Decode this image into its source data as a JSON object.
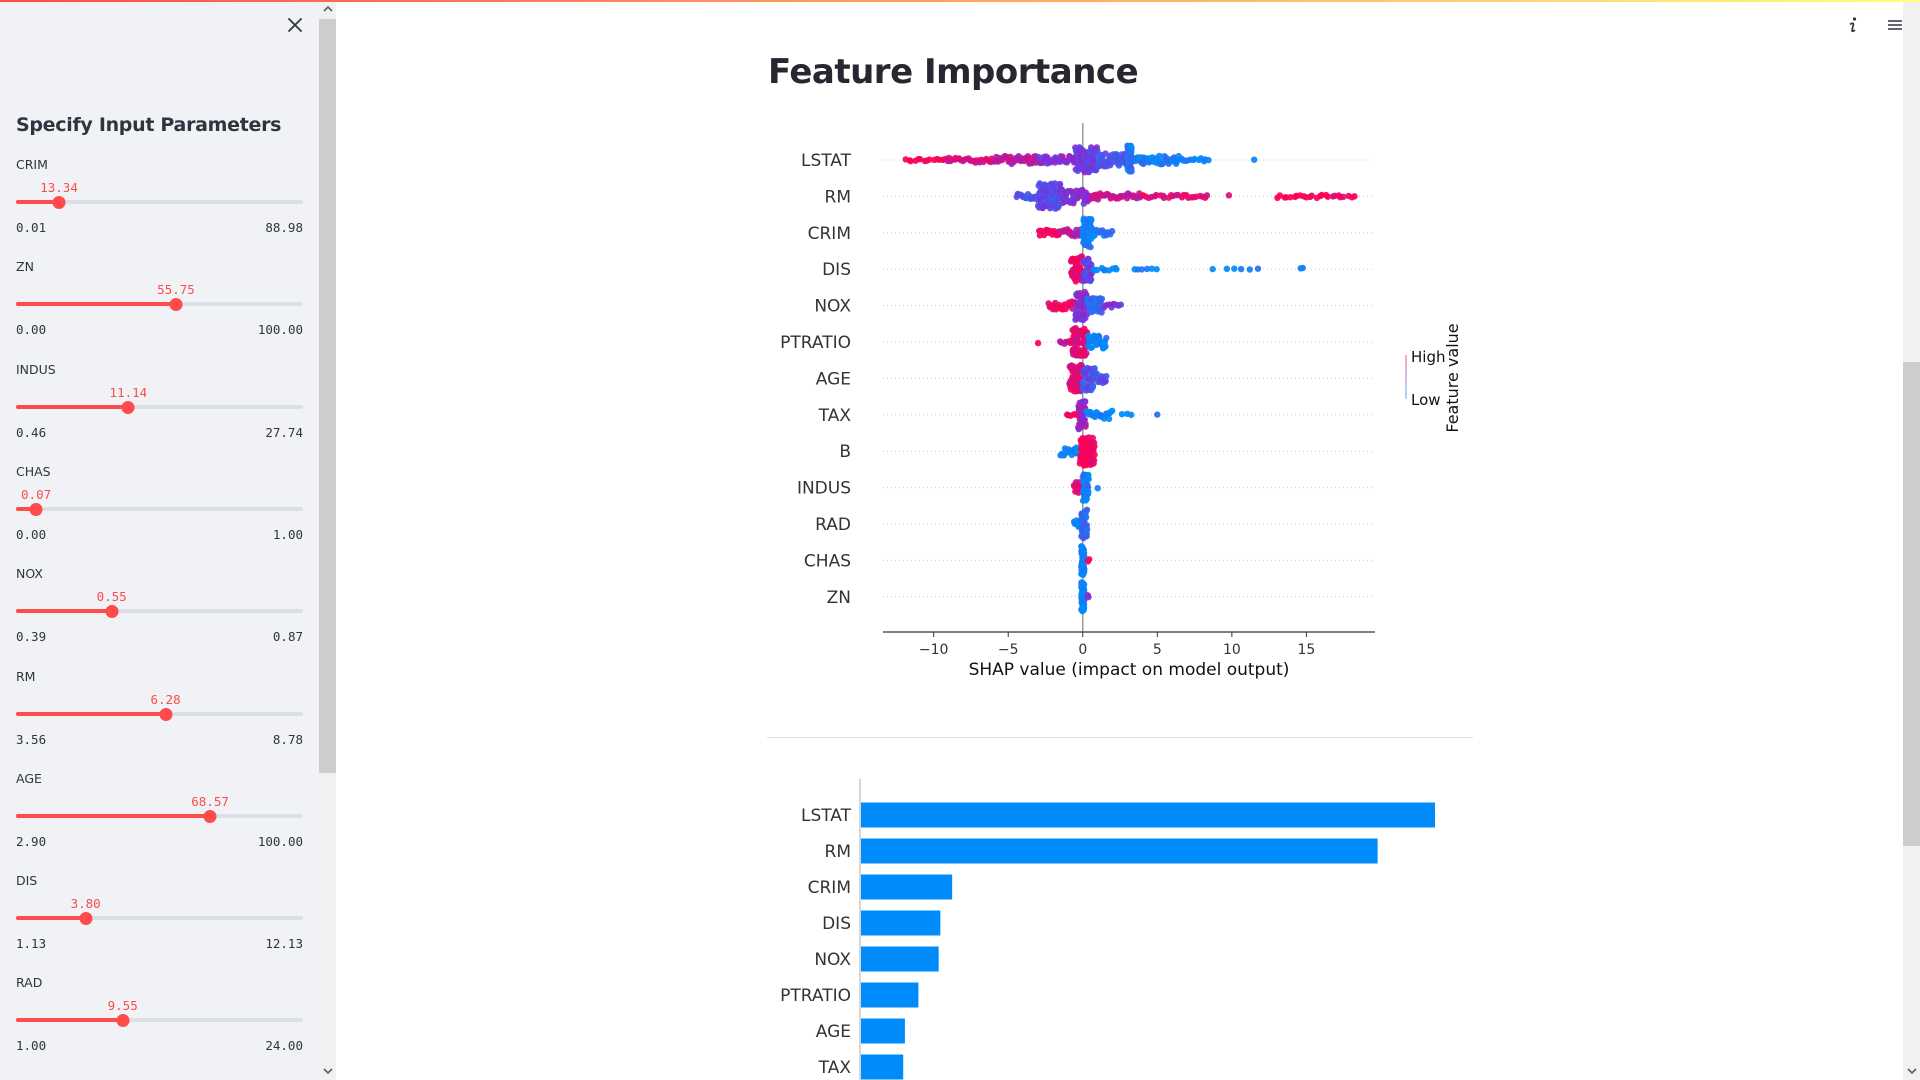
{
  "sidebar": {
    "close_label": "×",
    "heading": "Specify Input Parameters",
    "sliders": [
      {
        "label": "CRIM",
        "value": "13.34",
        "min": "0.01",
        "max": "88.98",
        "fraction": 0.15
      },
      {
        "label": "ZN",
        "value": "55.75",
        "min": "0.00",
        "max": "100.00",
        "fraction": 0.5575
      },
      {
        "label": "INDUS",
        "value": "11.14",
        "min": "0.46",
        "max": "27.74",
        "fraction": 0.3915
      },
      {
        "label": "CHAS",
        "value": "0.07",
        "min": "0.00",
        "max": "1.00",
        "fraction": 0.07
      },
      {
        "label": "NOX",
        "value": "0.55",
        "min": "0.39",
        "max": "0.87",
        "fraction": 0.3333
      },
      {
        "label": "RM",
        "value": "6.28",
        "min": "3.56",
        "max": "8.78",
        "fraction": 0.5211
      },
      {
        "label": "AGE",
        "value": "68.57",
        "min": "2.90",
        "max": "100.00",
        "fraction": 0.6763
      },
      {
        "label": "DIS",
        "value": "3.80",
        "min": "1.13",
        "max": "12.13",
        "fraction": 0.2427
      },
      {
        "label": "RAD",
        "value": "9.55",
        "min": "1.00",
        "max": "24.00",
        "fraction": 0.3717
      }
    ]
  },
  "header": {
    "info_icon": "info-icon",
    "menu_icon": "hamburger-menu-icon"
  },
  "main": {
    "title": "Feature Importance"
  },
  "colors": {
    "accent": "#ff4b4b",
    "shap_high": "#ff0052",
    "shap_low": "#008bfb",
    "bar": "#008bfb"
  },
  "chart_data": [
    {
      "type": "scatter",
      "subtype": "shap-beeswarm",
      "title": "",
      "xlabel": "SHAP value (impact on model output)",
      "ylabel": "",
      "xlim": [
        -13.4,
        19.6
      ],
      "xticks": [
        -10,
        -5,
        0,
        5,
        10,
        15
      ],
      "xtick_labels": [
        "−10",
        "−5",
        "0",
        "5",
        "10",
        "15"
      ],
      "grid": "dotted horizontal per feature",
      "legend": {
        "title": "Feature value",
        "high_label": "High",
        "low_label": "Low",
        "placement": "right"
      },
      "categories": [
        "LSTAT",
        "RM",
        "CRIM",
        "DIS",
        "NOX",
        "PTRATIO",
        "AGE",
        "TAX",
        "B",
        "INDUS",
        "RAD",
        "CHAS",
        "ZN"
      ],
      "clusters": {
        "LSTAT": [
          [
            -12.0,
            -9.5,
            1.0,
            12
          ],
          [
            -9.5,
            -6.0,
            0.85,
            30
          ],
          [
            -6.0,
            -3.0,
            0.7,
            40
          ],
          [
            -3.0,
            -0.5,
            0.5,
            35
          ],
          [
            -0.5,
            1.0,
            0.45,
            70
          ],
          [
            1.0,
            3.0,
            0.25,
            45
          ],
          [
            3.0,
            3.3,
            0.15,
            40
          ],
          [
            3.3,
            6.5,
            0.08,
            45
          ],
          [
            6.5,
            8.5,
            0.02,
            12
          ],
          [
            11.5,
            11.5,
            0.0,
            1
          ]
        ],
        "RM": [
          [
            -4.5,
            -3.0,
            0.3,
            15
          ],
          [
            -3.0,
            -1.5,
            0.35,
            70
          ],
          [
            -1.5,
            0.5,
            0.5,
            50
          ],
          [
            0.5,
            4.0,
            0.75,
            35
          ],
          [
            4.0,
            8.5,
            0.9,
            25
          ],
          [
            9.8,
            9.8,
            1.0,
            1
          ],
          [
            13.0,
            18.3,
            1.0,
            25
          ]
        ],
        "CRIM": [
          [
            -3.0,
            -1.5,
            0.95,
            15
          ],
          [
            -1.5,
            0.0,
            0.7,
            20
          ],
          [
            0.0,
            0.6,
            0.05,
            60
          ],
          [
            0.6,
            2.0,
            0.1,
            15
          ]
        ],
        "DIS": [
          [
            -0.8,
            0.0,
            0.95,
            40
          ],
          [
            0.0,
            0.6,
            0.4,
            30
          ],
          [
            0.6,
            2.4,
            0.0,
            10
          ],
          [
            3.2,
            5.2,
            0.0,
            6
          ],
          [
            8.7,
            11.9,
            0.0,
            6
          ],
          [
            14.6,
            14.9,
            0.0,
            2
          ]
        ],
        "NOX": [
          [
            -2.3,
            -0.5,
            0.95,
            25
          ],
          [
            -0.5,
            0.3,
            0.5,
            50
          ],
          [
            0.3,
            1.3,
            0.15,
            30
          ],
          [
            1.3,
            2.6,
            0.5,
            10
          ]
        ],
        "PTRATIO": [
          [
            -3.0,
            -3.0,
            1.0,
            1
          ],
          [
            -1.6,
            -0.3,
            0.8,
            10
          ],
          [
            -0.7,
            0.3,
            0.9,
            60
          ],
          [
            0.3,
            1.6,
            0.0,
            30
          ]
        ],
        "AGE": [
          [
            -0.9,
            0.0,
            0.9,
            50
          ],
          [
            0.0,
            0.8,
            0.3,
            40
          ],
          [
            0.8,
            1.6,
            0.3,
            15
          ]
        ],
        "TAX": [
          [
            -1.1,
            -0.3,
            0.95,
            6
          ],
          [
            -0.3,
            0.2,
            0.6,
            40
          ],
          [
            0.2,
            2.0,
            0.0,
            25
          ],
          [
            2.6,
            3.3,
            0.0,
            3
          ],
          [
            5.0,
            5.0,
            0.0,
            1
          ]
        ],
        "B": [
          [
            -1.5,
            -0.2,
            0.0,
            20
          ],
          [
            -0.2,
            0.8,
            1.0,
            70
          ]
        ],
        "INDUS": [
          [
            -0.6,
            0.0,
            0.9,
            15
          ],
          [
            0.0,
            0.4,
            0.1,
            35
          ],
          [
            1.0,
            1.0,
            0.0,
            1
          ]
        ],
        "RAD": [
          [
            -0.6,
            -0.1,
            0.0,
            8
          ],
          [
            -0.1,
            0.3,
            0.2,
            40
          ]
        ],
        "CHAS": [
          [
            -0.1,
            0.1,
            0.0,
            60
          ],
          [
            0.3,
            0.45,
            1.0,
            2
          ]
        ],
        "ZN": [
          [
            -0.1,
            0.1,
            0.0,
            60
          ],
          [
            0.3,
            0.45,
            0.6,
            2
          ]
        ]
      }
    },
    {
      "type": "bar",
      "orientation": "horizontal",
      "subtype": "mean-abs-shap",
      "title": "",
      "xlabel": "",
      "categories": [
        "LSTAT",
        "RM",
        "CRIM",
        "DIS",
        "NOX",
        "PTRATIO",
        "AGE",
        "TAX"
      ],
      "values": [
        3.4,
        3.06,
        0.54,
        0.47,
        0.46,
        0.34,
        0.26,
        0.25
      ],
      "xlim": [
        0,
        3.4
      ]
    }
  ]
}
